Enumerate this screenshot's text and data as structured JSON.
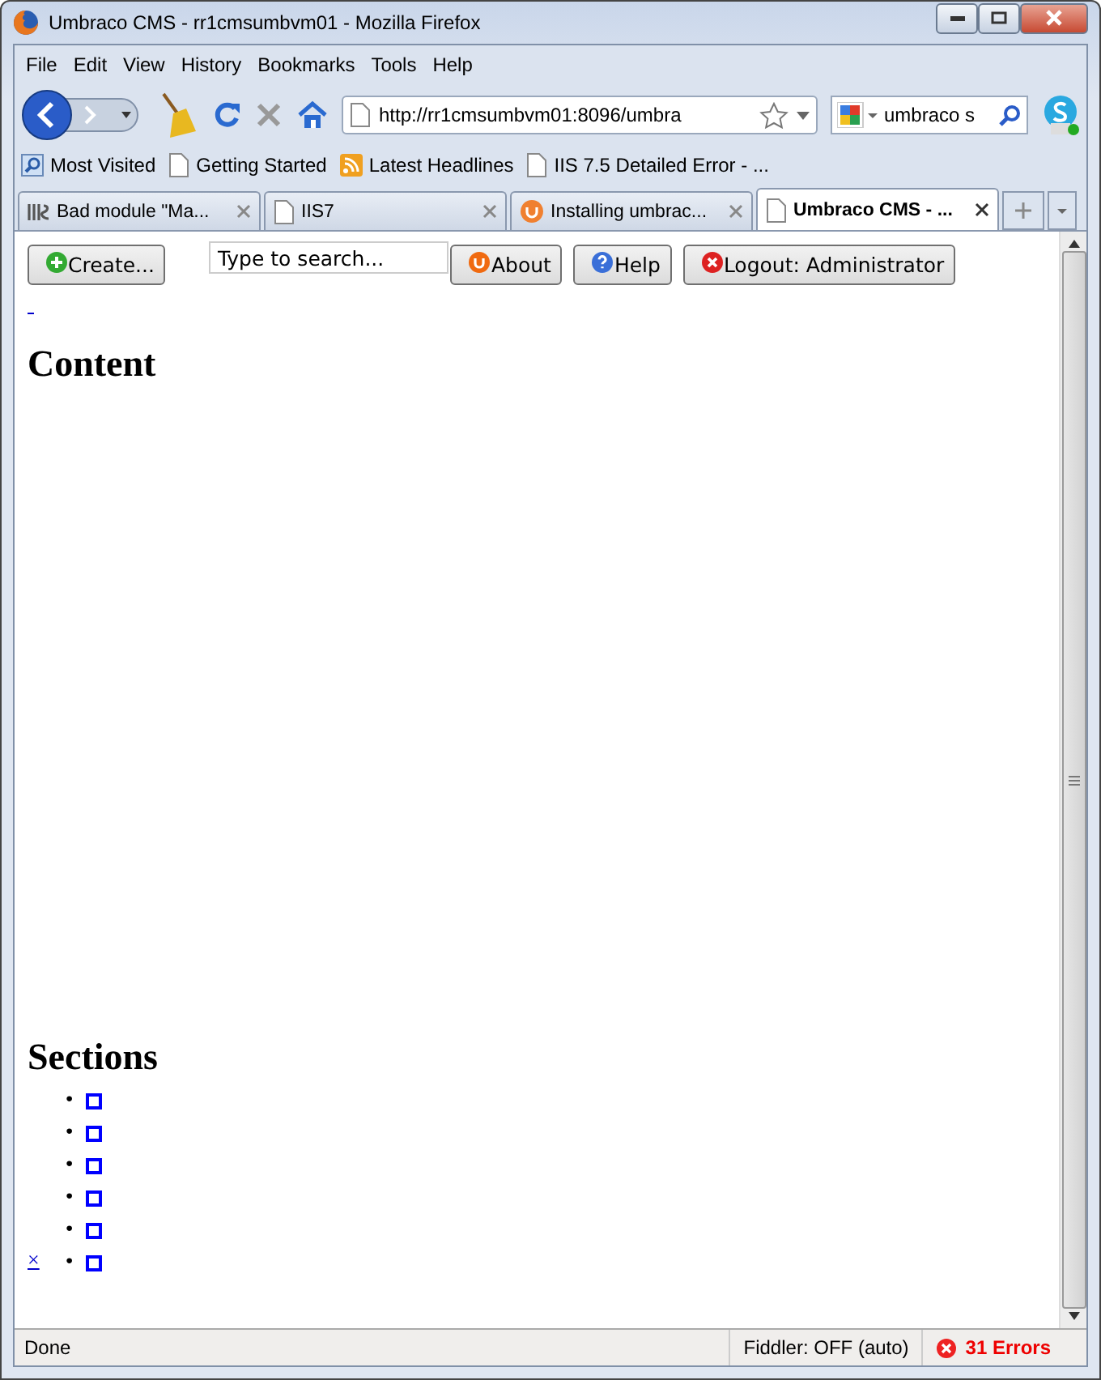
{
  "window": {
    "title": "Umbraco CMS - rr1cmsumbvm01 - Mozilla Firefox"
  },
  "menu": [
    "File",
    "Edit",
    "View",
    "History",
    "Bookmarks",
    "Tools",
    "Help"
  ],
  "address_bar": {
    "value": "http://rr1cmsumbvm01:8096/umbra"
  },
  "search_box": {
    "value": "umbraco s"
  },
  "bookmarks": [
    {
      "label": "Most Visited",
      "kind": "search"
    },
    {
      "label": "Getting Started",
      "kind": "page"
    },
    {
      "label": "Latest Headlines",
      "kind": "feed"
    },
    {
      "label": "IIS 7.5 Detailed Error - ...",
      "kind": "page"
    }
  ],
  "tabs": [
    {
      "label": "Bad module \"Ma...",
      "kind": "iis",
      "selected": false
    },
    {
      "label": "IIS7",
      "kind": "page",
      "selected": false
    },
    {
      "label": "Installing umbrac...",
      "kind": "umbraco",
      "selected": false
    },
    {
      "label": "Umbraco CMS - ...",
      "kind": "page",
      "selected": true
    }
  ],
  "page": {
    "toolbar": [
      {
        "label": "Create...",
        "kind": "create"
      },
      {
        "kind": "search",
        "placeholder": "Type to search..."
      },
      {
        "label": "About",
        "kind": "about"
      },
      {
        "label": "Help",
        "kind": "help"
      },
      {
        "label": "Logout: Administrator",
        "kind": "logout"
      }
    ],
    "content_heading": "Content",
    "sections_heading": "Sections",
    "sections": [
      {
        "kind": "broken-image",
        "marker": "•"
      },
      {
        "kind": "broken-image",
        "marker": "•"
      },
      {
        "kind": "broken-image",
        "marker": "•"
      },
      {
        "kind": "broken-image",
        "marker": "•"
      },
      {
        "kind": "broken-image",
        "marker": "•"
      },
      {
        "kind": "broken-image",
        "marker": "•"
      }
    ],
    "close_link": "×"
  },
  "status_bar": {
    "status": "Done",
    "fiddler": "Fiddler: OFF (auto)",
    "errors": "31 Errors"
  }
}
